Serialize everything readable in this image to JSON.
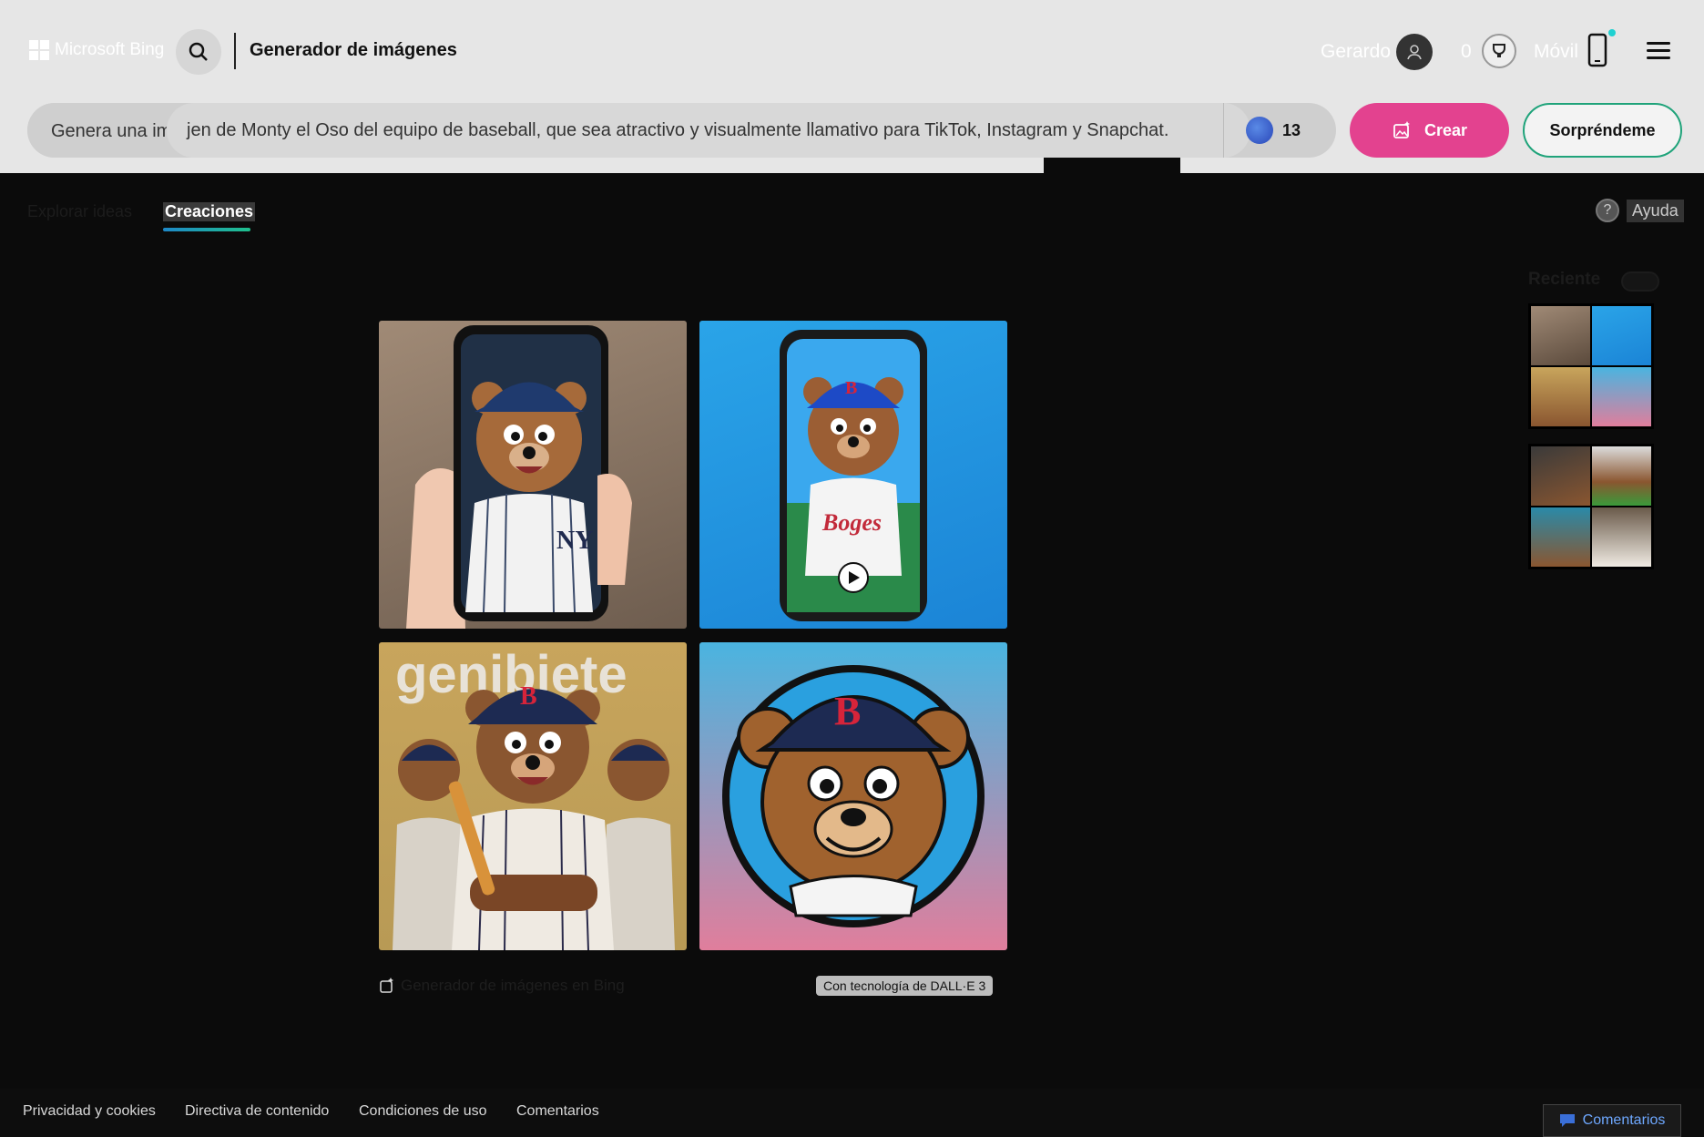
{
  "header": {
    "logo_text": "Microsoft Bing",
    "title": "Generador de imágenes",
    "user_name": "Gerardo",
    "rewards_count": "0",
    "mobile_label": "Móvil"
  },
  "prompt": {
    "prefix": "Genera una im",
    "value": "jen de Monty el Oso del equipo de baseball, que sea atractivo y visualmente llamativo para TikTok, Instagram y Snapchat.",
    "boosts": "13",
    "create_label": "Crear",
    "surprise_label": "Sorpréndeme"
  },
  "tabs": {
    "explore": "Explorar ideas",
    "creations": "Creaciones"
  },
  "help_label": "Ayuda",
  "results": {
    "generator_link": "Generador de imágenes en Bing",
    "badge": "Con tecnología de DALL·E 3"
  },
  "recent": {
    "label": "Reciente"
  },
  "footer": {
    "links": [
      "Privacidad y cookies",
      "Directiva de contenido",
      "Condiciones de uso",
      "Comentarios"
    ],
    "feedback": "Comentarios"
  },
  "colors": {
    "create": "#e3428f",
    "surprise_border": "#1fa37a",
    "tab_underline": "#1fc08d"
  }
}
